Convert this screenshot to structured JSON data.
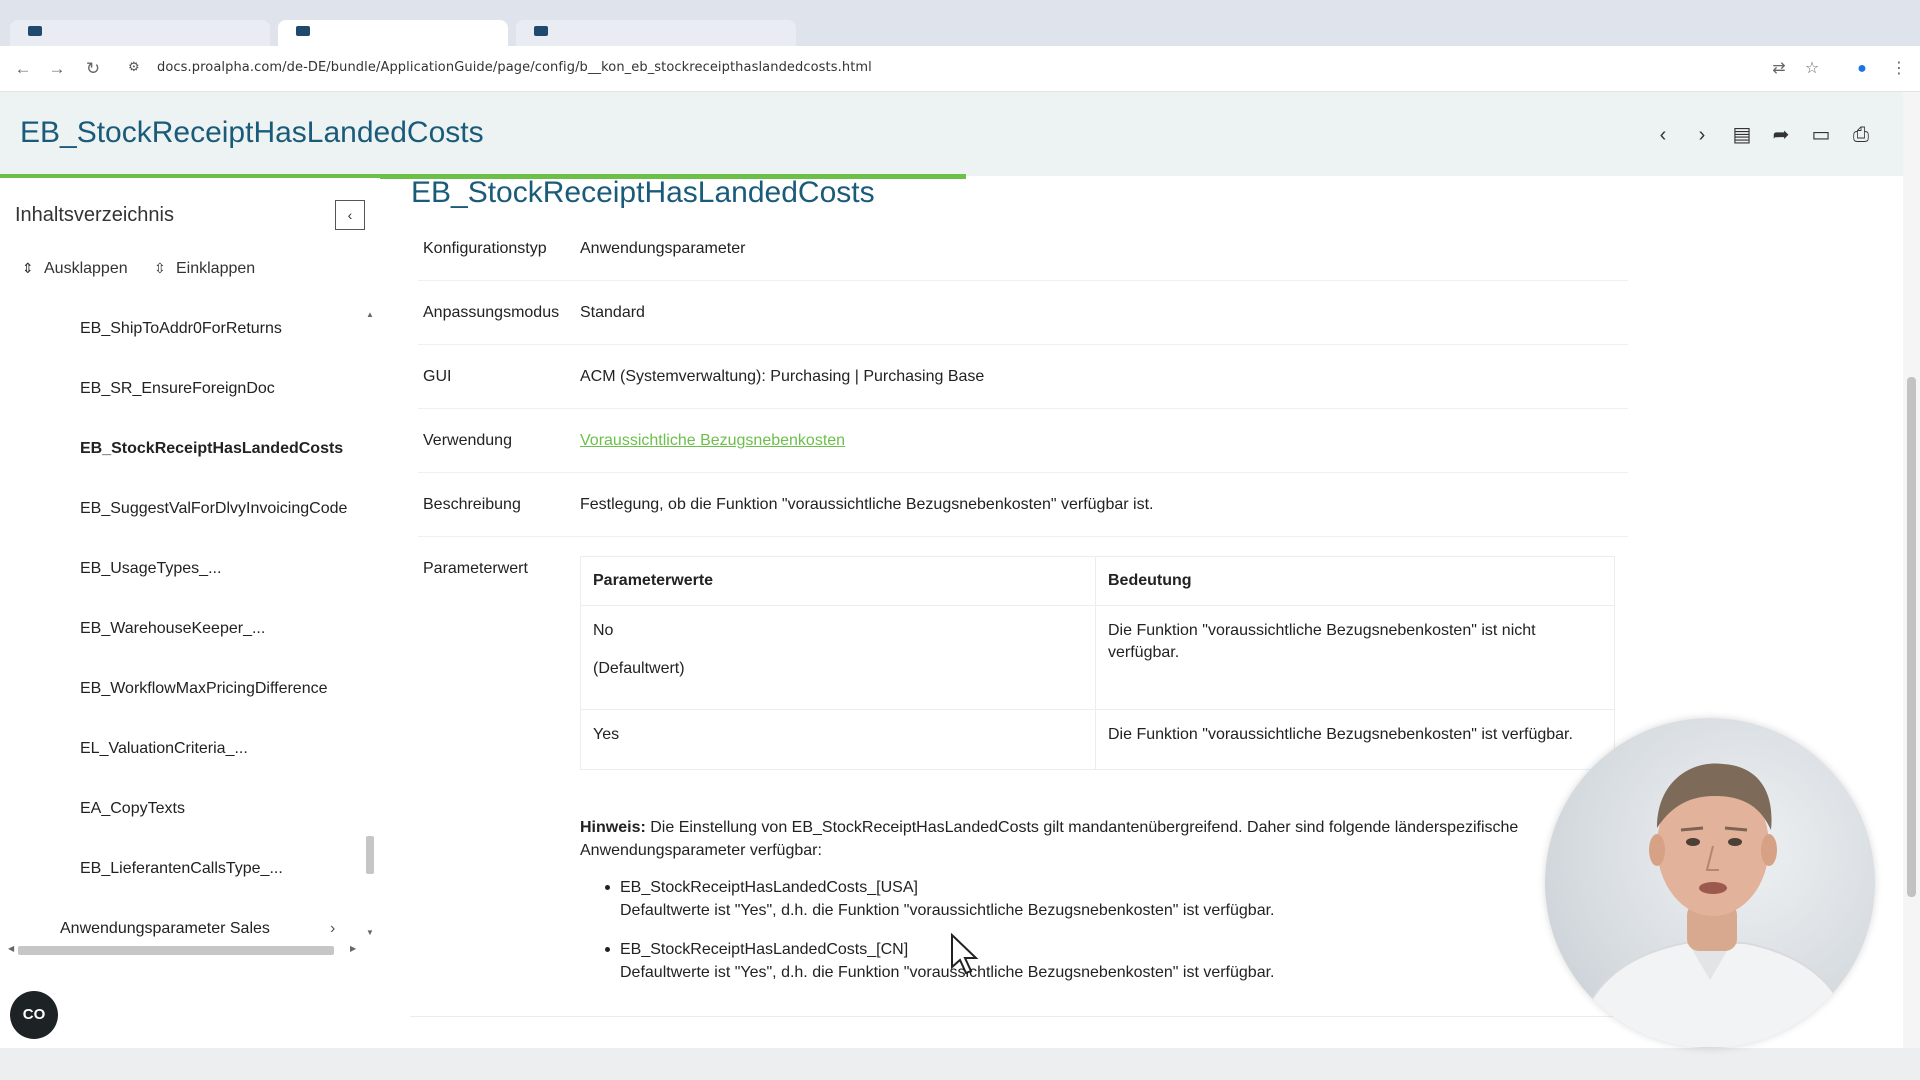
{
  "browser": {
    "url": "docs.proalpha.com/de-DE/bundle/ApplicationGuide/page/config/b__kon_eb_stockreceipthaslandedcosts.html"
  },
  "header": {
    "title": "EB_StockReceiptHasLandedCosts"
  },
  "sidebar": {
    "title": "Inhaltsverzeichnis",
    "expand_label": "Ausklappen",
    "collapse_label": "Einklappen",
    "items": [
      {
        "label": "EB_ShipToAddr0ForReturns",
        "active": false
      },
      {
        "label": "EB_SR_EnsureForeignDoc",
        "active": false
      },
      {
        "label": "EB_StockReceiptHasLandedCosts",
        "active": true
      },
      {
        "label": "EB_SuggestValForDlvyInvoicingCode",
        "active": false
      },
      {
        "label": "EB_UsageTypes_...",
        "active": false
      },
      {
        "label": "EB_WarehouseKeeper_...",
        "active": false
      },
      {
        "label": "EB_WorkflowMaxPricingDifference",
        "active": false
      },
      {
        "label": "EL_ValuationCriteria_...",
        "active": false
      },
      {
        "label": "EA_CopyTexts",
        "active": false
      },
      {
        "label": "EB_LieferantenCallsType_...",
        "active": false
      }
    ],
    "group_label": "Anwendungsparameter Sales",
    "cc_label": "CO"
  },
  "main": {
    "title": "EB_StockReceiptHasLandedCosts",
    "rows": {
      "konfig": {
        "label": "Konfigurationstyp",
        "value": "Anwendungsparameter"
      },
      "modus": {
        "label": "Anpassungsmodus",
        "value": "Standard"
      },
      "gui": {
        "label": "GUI",
        "value": "ACM (Systemverwaltung): Purchasing | Purchasing Base"
      },
      "verwendung": {
        "label": "Verwendung",
        "value": "Voraussichtliche Bezugsnebenkosten"
      },
      "beschreibung": {
        "label": "Beschreibung",
        "value": "Festlegung, ob die Funktion \"voraussichtliche Bezugsnebenkosten\" verfügbar ist."
      },
      "parameterwert": {
        "label": "Parameterwert"
      }
    },
    "table": {
      "headers": [
        "Parameterwerte",
        "Bedeutung"
      ],
      "rows": [
        {
          "value": "No",
          "sub": "(Defaultwert)",
          "meaning": "Die Funktion \"voraussichtliche Bezugsnebenkosten\" ist nicht verfügbar."
        },
        {
          "value": "Yes",
          "sub": "",
          "meaning": "Die Funktion \"voraussichtliche Bezugsnebenkosten\" ist verfügbar."
        }
      ]
    },
    "hinweis": {
      "label": "Hinweis:",
      "text": " Die Einstellung von EB_StockReceiptHasLandedCosts gilt mandantenübergreifend. Daher sind folgende länderspezifische Anwendungsparameter verfügbar:"
    },
    "bullets": [
      {
        "name": "EB_StockReceiptHasLandedCosts_[USA]",
        "desc": "Defaultwerte ist \"Yes\", d.h. die Funktion \"voraussichtliche Bezugsnebenkosten\" ist verfügbar."
      },
      {
        "name": "EB_StockReceiptHasLandedCosts_[CN]",
        "desc": "Defaultwerte ist \"Yes\", d.h. die Funktion \"voraussichtliche Bezugsnebenkosten\" ist verfügbar."
      }
    ]
  },
  "colors": {
    "title_blue": "#1b5b7a",
    "accent_green": "#6cc04a",
    "header_bg": "#edf3f2"
  }
}
